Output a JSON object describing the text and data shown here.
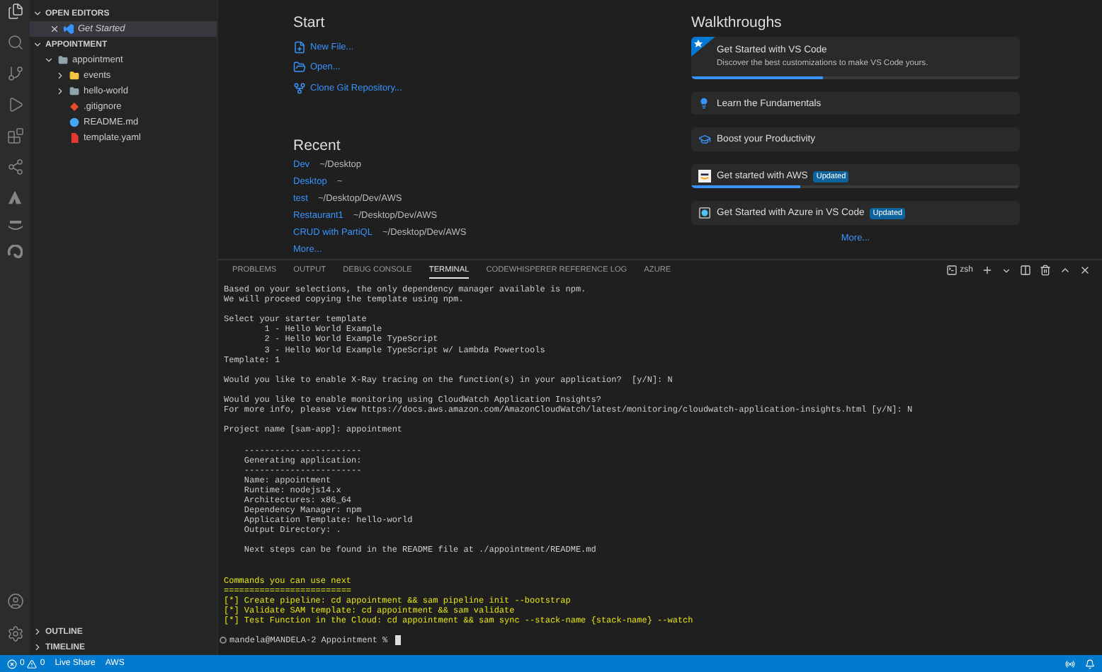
{
  "sidebar": {
    "open_editors": {
      "title": "OPEN EDITORS",
      "expanded": true,
      "items": [
        {
          "label": "Get Started",
          "selected": true
        }
      ]
    },
    "explorer": {
      "title": "APPOINTMENT",
      "expanded": true,
      "tree": [
        {
          "label": "appointment",
          "kind": "folder",
          "expanded": true,
          "children": [
            {
              "label": "events",
              "kind": "special-folder",
              "expanded": false
            },
            {
              "label": "hello-world",
              "kind": "folder",
              "expanded": false
            },
            {
              "label": ".gitignore",
              "kind": "git"
            },
            {
              "label": "README.md",
              "kind": "markdown"
            },
            {
              "label": "template.yaml",
              "kind": "yaml"
            }
          ]
        }
      ]
    },
    "bottom_sections": [
      {
        "title": "OUTLINE",
        "expanded": false
      },
      {
        "title": "TIMELINE",
        "expanded": false
      }
    ]
  },
  "welcome": {
    "start": {
      "title": "Start",
      "actions": [
        {
          "label": "New File...",
          "kind": "new-file"
        },
        {
          "label": "Open...",
          "kind": "open"
        },
        {
          "label": "Clone Git Repository...",
          "kind": "clone"
        }
      ]
    },
    "recent": {
      "title": "Recent",
      "items": [
        {
          "name": "Dev",
          "path": "~/Desktop"
        },
        {
          "name": "Desktop",
          "path": "~"
        },
        {
          "name": "test",
          "path": "~/Desktop/Dev/AWS"
        },
        {
          "name": "Restaurant1",
          "path": "~/Desktop/Dev/AWS"
        },
        {
          "name": "CRUD with PartiQL",
          "path": "~/Desktop/Dev/AWS"
        }
      ],
      "more": "More..."
    },
    "walkthroughs": {
      "title": "Walkthroughs",
      "items": [
        {
          "title": "Get Started with VS Code",
          "description": "Discover the best customizations to make VS Code yours.",
          "kind": "featured",
          "level": 0.4
        },
        {
          "title": "Learn the Fundamentals",
          "kind": "bulb"
        },
        {
          "title": "Boost your Productivity",
          "kind": "cap"
        },
        {
          "title": "Get started with AWS",
          "kind": "aws",
          "badge": "Updated",
          "level": 0.33
        },
        {
          "title": "Get Started with Azure in VS Code",
          "kind": "azure",
          "badge": "Updated"
        }
      ],
      "more": "More..."
    }
  },
  "panel": {
    "tabs": [
      {
        "label": "PROBLEMS",
        "selected": false
      },
      {
        "label": "OUTPUT",
        "selected": false
      },
      {
        "label": "DEBUG CONSOLE",
        "selected": false
      },
      {
        "label": "TERMINAL",
        "selected": true
      },
      {
        "label": "CODEWHISPERER REFERENCE LOG",
        "selected": false
      },
      {
        "label": "AZURE",
        "selected": false
      }
    ],
    "shell": "zsh",
    "terminal": {
      "blocks": [
        {
          "kind": "output",
          "lines": [
            "Based on your selections, the only dependency manager available is npm.",
            "We will proceed copying the template using npm."
          ]
        },
        {
          "kind": "output",
          "lines": [
            "Select your starter template",
            "        1 - Hello World Example",
            "        2 - Hello World Example TypeScript",
            "        3 - Hello World Example TypeScript w/ Lambda Powertools",
            "Template: 1"
          ]
        },
        {
          "kind": "output",
          "lines": [
            "Would you like to enable X-Ray tracing on the function(s) in your application?  [y/N]: N"
          ]
        },
        {
          "kind": "output",
          "lines": [
            "Would you like to enable monitoring using CloudWatch Application Insights?",
            "For more info, please view https://docs.aws.amazon.com/AmazonCloudWatch/latest/monitoring/cloudwatch-application-insights.html [y/N]: N"
          ]
        },
        {
          "kind": "output",
          "lines": [
            "Project name [sam-app]: appointment"
          ]
        },
        {
          "kind": "output",
          "lines": [
            "    -----------------------",
            "    Generating application:",
            "    -----------------------",
            "    Name: appointment",
            "    Runtime: nodejs14.x",
            "    Architectures: x86_64",
            "    Dependency Manager: npm",
            "    Application Template: hello-world",
            "    Output Directory: ."
          ]
        },
        {
          "kind": "output",
          "lines": [
            "    Next steps can be found in the README file at ./appointment/README.md"
          ]
        },
        {
          "kind": "highlight",
          "lines": [
            "Commands you can use next",
            "=========================",
            "[*] Create pipeline: cd appointment && sam pipeline init --bootstrap",
            "[*] Validate SAM template: cd appointment && sam validate",
            "[*] Test Function in the Cloud: cd appointment && sam sync --stack-name {stack-name} --watch"
          ]
        }
      ],
      "prompt": "mandela@MANDELA-2 Appointment %"
    }
  },
  "status_bar": {
    "errors": "0",
    "warnings": "0",
    "items": [
      "Live Share",
      "AWS"
    ]
  }
}
